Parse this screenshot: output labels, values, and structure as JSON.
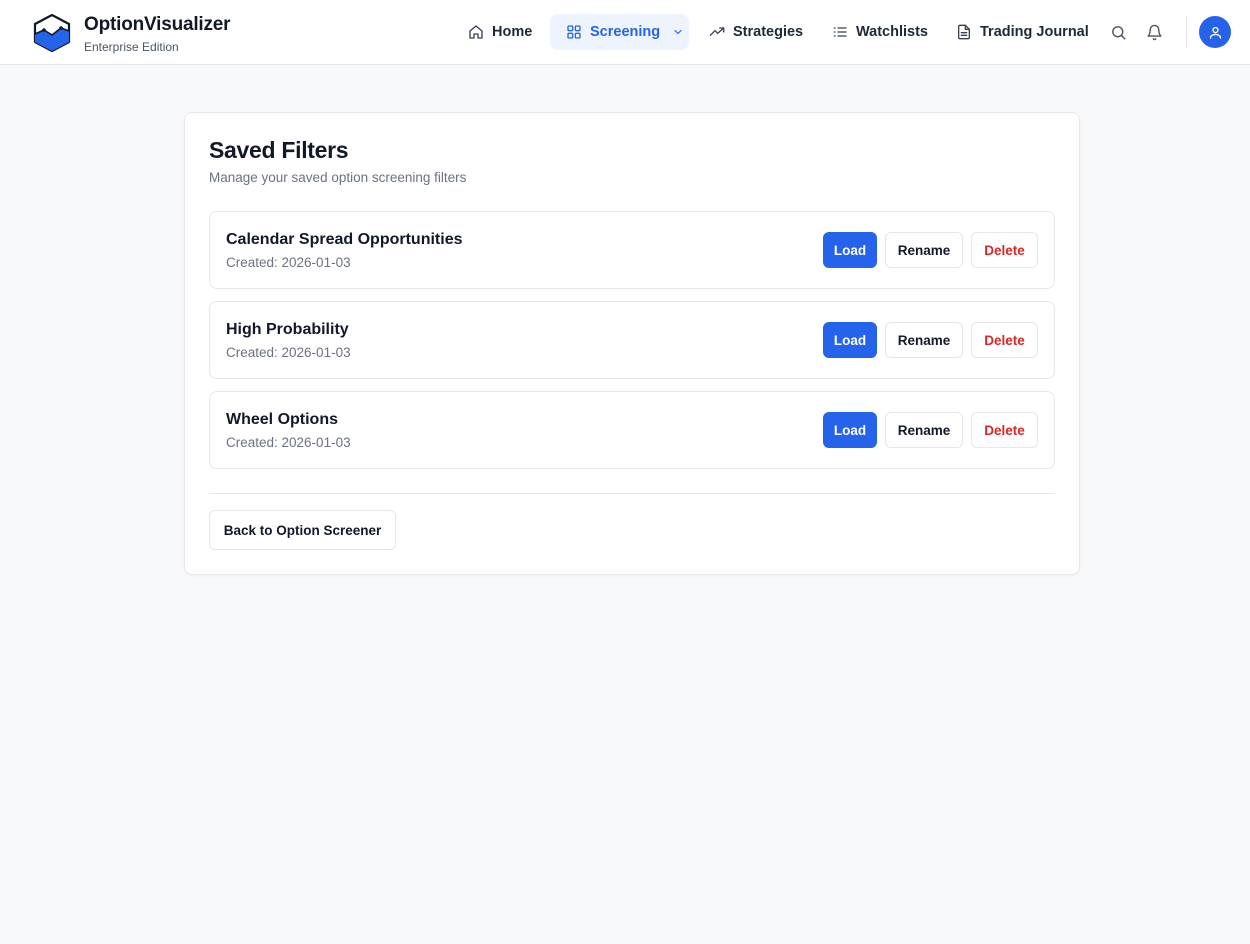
{
  "header": {
    "app_name": "OptionVisualizer",
    "edition": "Enterprise Edition",
    "nav": [
      {
        "label": "Home",
        "icon": "home-icon"
      },
      {
        "label": "Screening",
        "icon": "grid-icon",
        "active": true,
        "has_dropdown": true
      },
      {
        "label": "Strategies",
        "icon": "trending-up-icon"
      },
      {
        "label": "Watchlists",
        "icon": "list-icon"
      },
      {
        "label": "Trading Journal",
        "icon": "document-icon"
      }
    ],
    "actions": [
      "search-icon",
      "bell-icon",
      "user-icon"
    ]
  },
  "page": {
    "title": "Saved Filters",
    "subtitle": "Manage your saved option screening filters",
    "filters": [
      {
        "name": "Calendar Spread Opportunities",
        "created": "Created: 2026-01-03"
      },
      {
        "name": "High Probability",
        "created": "Created: 2026-01-03"
      },
      {
        "name": "Wheel Options",
        "created": "Created: 2026-01-03"
      }
    ],
    "row_actions": {
      "load": "Load",
      "rename": "Rename",
      "delete": "Delete"
    },
    "back_label": "Back to Option Screener"
  },
  "colors": {
    "accent": "#2563eb",
    "accent_bg": "#eef4fe",
    "danger": "#dc2626",
    "page_bg": "#f8f9fb",
    "border": "#e5e7eb"
  }
}
